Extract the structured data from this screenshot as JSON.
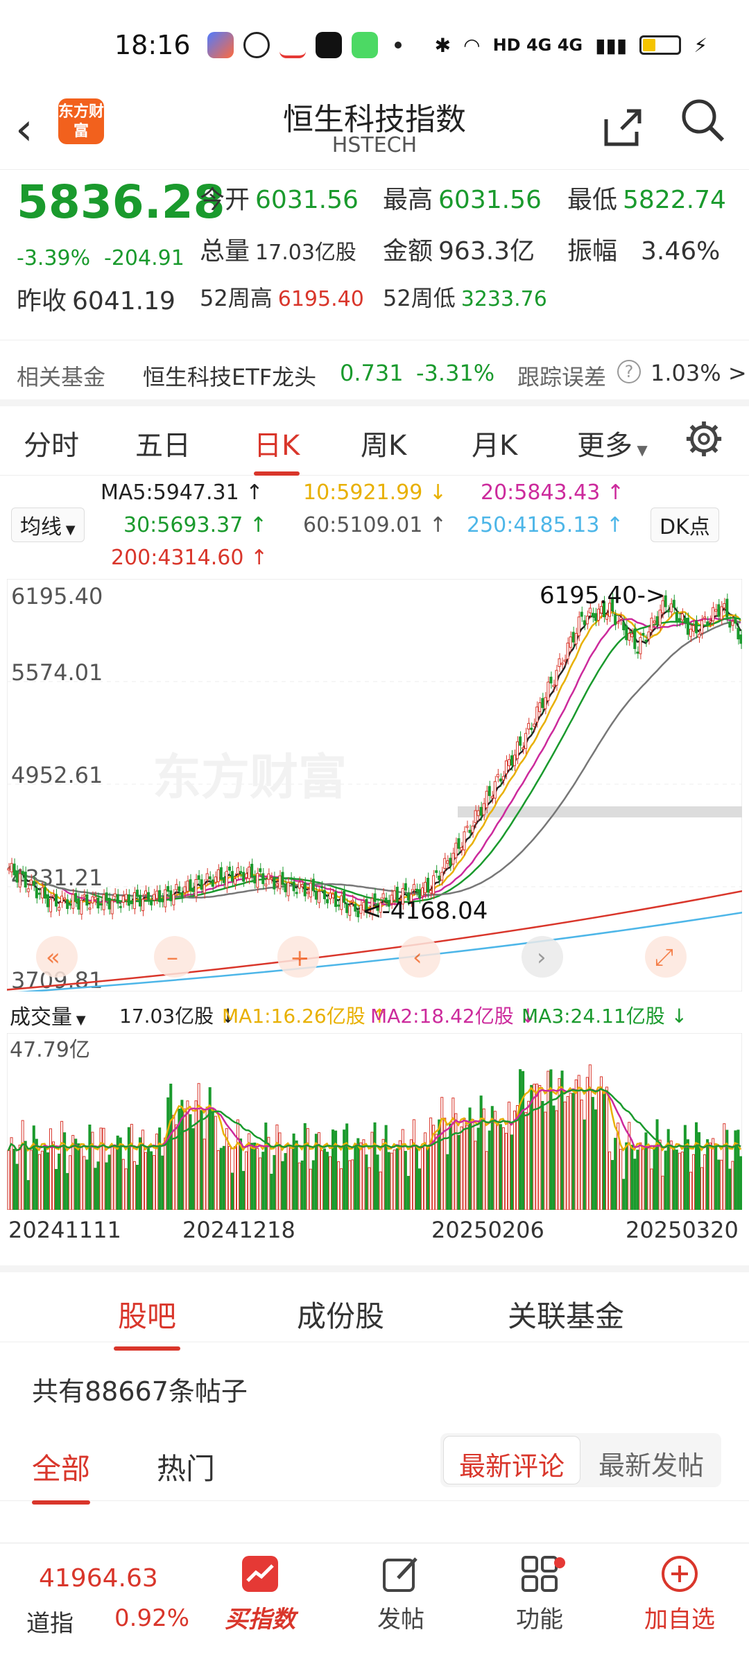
{
  "status_bar": {
    "time": "18:16",
    "network": "HD 4G 4G"
  },
  "header": {
    "logo_text": "东方财富",
    "title": "恒生科技指数",
    "subtitle": "HSTECH"
  },
  "quote": {
    "price": "5836.28",
    "change_pct": "-3.39%",
    "change": "-204.91",
    "open_label": "今开",
    "open": "6031.56",
    "high_label": "最高",
    "high": "6031.56",
    "low_label": "最低",
    "low": "5822.74",
    "volume_label": "总量",
    "volume": "17.03亿股",
    "amount_label": "金额",
    "amount": "963.3亿",
    "amplitude_label": "振幅",
    "amplitude": "3.46%",
    "prev_close_label": "昨收",
    "prev_close": "6041.19",
    "w52_high_label": "52周高",
    "w52_high": "6195.40",
    "w52_low_label": "52周低",
    "w52_low": "3233.76"
  },
  "fund": {
    "label": "相关基金",
    "name": "恒生科技ETF龙头",
    "price": "0.731",
    "pct": "-3.31%",
    "track_label": "跟踪误差",
    "track_value": "1.03% >"
  },
  "kline_tabs": [
    "分时",
    "五日",
    "日K",
    "周K",
    "月K",
    "更多"
  ],
  "ma_legend": {
    "selector": "均线",
    "dk": "DK点",
    "ma5": "MA5:5947.31 ↑",
    "ma10": "10:5921.99 ↓",
    "ma20": "20:5843.43 ↑",
    "ma30": "30:5693.37 ↑",
    "ma60": "60:5109.01 ↑",
    "ma250": "250:4185.13 ↑",
    "ma200": "200:4314.60 ↑"
  },
  "kchart_labels": {
    "y_top": "6195.40",
    "y2": "5574.01",
    "y3": "4952.61",
    "y4": "4331.21",
    "y_bottom": "3709.81",
    "max_note": "6195.40->",
    "min_note": "<-4168.04",
    "watermark": "东方财富"
  },
  "volume": {
    "selector": "成交量",
    "total": "17.03亿股 ↓",
    "ma1": "MA1:16.26亿股 ↑",
    "ma2": "MA2:18.42亿股 ↓",
    "ma3": "MA3:24.11亿股 ↓",
    "max_label": "47.79亿"
  },
  "dates": [
    "20241111",
    "20241218",
    "20250206",
    "20250320"
  ],
  "section_tabs": [
    "股吧",
    "成份股",
    "关联基金"
  ],
  "posts_count": "共有88667条帖子",
  "feed_tabs": [
    "全部",
    "热门"
  ],
  "sort": {
    "selected": "最新评论",
    "other": "最新发帖"
  },
  "bottom_nav": {
    "index_value": "41964.63",
    "index_name": "道指",
    "index_pct": "0.92%",
    "items": [
      "买指数",
      "发帖",
      "功能",
      "加自选"
    ]
  },
  "colors": {
    "up": "#d9362b",
    "down": "#1a9a2d",
    "accent": "#f2611d"
  },
  "chart_data": {
    "type": "candlestick",
    "ylim": [
      3709.81,
      6195.4
    ],
    "x_range": [
      "20241111",
      "20250320"
    ],
    "max": 6195.4,
    "min": 4168.04,
    "volume_max": "47.79亿"
  }
}
